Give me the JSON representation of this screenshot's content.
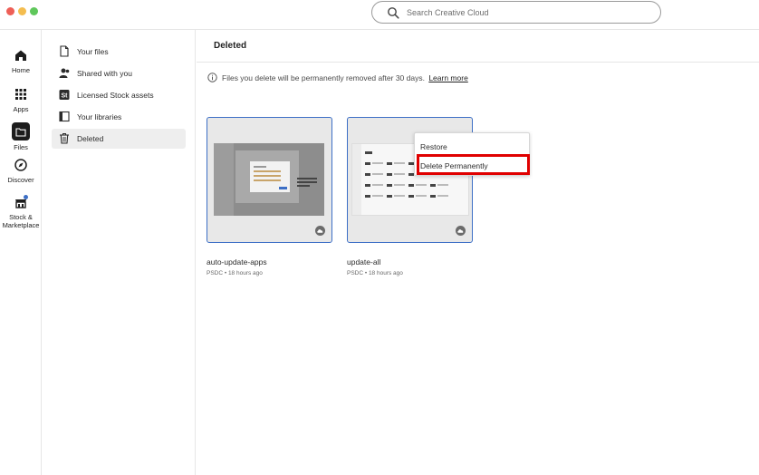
{
  "window": {
    "search": {
      "placeholder": "Search Creative Cloud",
      "value": ""
    }
  },
  "rail": {
    "items": [
      {
        "label": "Home",
        "icon": "home-icon"
      },
      {
        "label": "Apps",
        "icon": "apps-grid-icon"
      },
      {
        "label": "Files",
        "icon": "folder-icon",
        "active": true
      },
      {
        "label": "Discover",
        "icon": "compass-icon"
      },
      {
        "label": "Stock &",
        "label2": "Marketplace",
        "icon": "stock-marketplace-icon"
      }
    ]
  },
  "sidebar": {
    "items": [
      {
        "label": "Your files",
        "icon": "file-icon"
      },
      {
        "label": "Shared with you",
        "icon": "users-icon"
      },
      {
        "label": "Licensed Stock assets",
        "icon": "stock-icon"
      },
      {
        "label": "Your libraries",
        "icon": "library-icon"
      },
      {
        "label": "Deleted",
        "icon": "trash-icon",
        "active": true
      }
    ]
  },
  "main": {
    "title": "Deleted",
    "notice": "Files you delete will be permanently removed after 30 days.",
    "learn_more": "Learn more",
    "files": [
      {
        "name": "auto-update-apps",
        "meta": "PSDC • 18 hours ago"
      },
      {
        "name": "update-all",
        "meta": "PSDC • 18 hours ago"
      }
    ],
    "context_menu": {
      "restore": "Restore",
      "delete_permanently": "Delete Permanently"
    }
  },
  "colors": {
    "selection_border": "#3d6fc6",
    "highlight": "#e00000"
  }
}
